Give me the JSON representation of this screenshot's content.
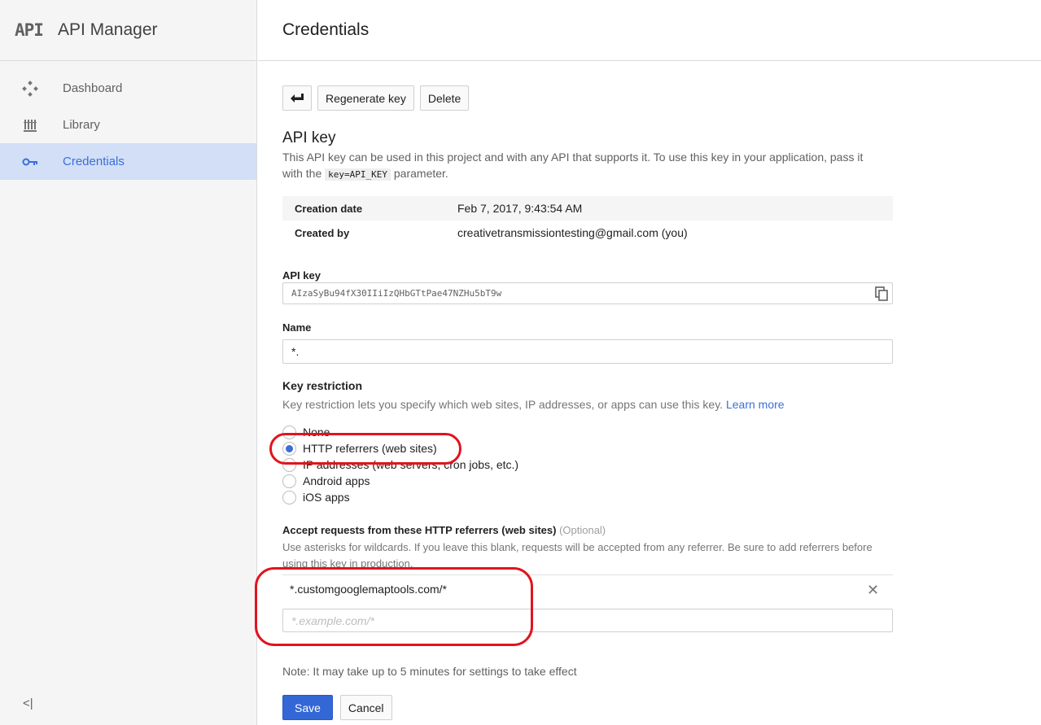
{
  "brand": {
    "logo": "API",
    "title": "API Manager"
  },
  "sidebar": {
    "items": [
      {
        "label": "Dashboard",
        "icon": "dashboard-icon"
      },
      {
        "label": "Library",
        "icon": "library-icon"
      },
      {
        "label": "Credentials",
        "icon": "key-icon",
        "active": true
      }
    ],
    "collapse_label": "<|"
  },
  "header": {
    "title": "Credentials"
  },
  "toolbar": {
    "back_icon": "back-arrow-icon",
    "regenerate_label": "Regenerate key",
    "delete_label": "Delete"
  },
  "apikey_section": {
    "title": "API key",
    "description_before": "This API key can be used in this project and with any API that supports it. To use this key in your application, pass it with the ",
    "code": "key=API_KEY",
    "description_after": " parameter."
  },
  "info": [
    {
      "key": "Creation date",
      "value": "Feb 7, 2017, 9:43:54 AM"
    },
    {
      "key": "Created by",
      "value": "creativetransmissiontesting@gmail.com (you)"
    }
  ],
  "api_key_field": {
    "label": "API key",
    "value": "AIzaSyBu94fX30IIiIzQHbGTtPae47NZHu5bT9w"
  },
  "name_field": {
    "label": "Name",
    "value": "*."
  },
  "key_restriction": {
    "title": "Key restriction",
    "description": "Key restriction lets you specify which web sites, IP addresses, or apps can use this key. ",
    "learn_more": "Learn more",
    "options": [
      {
        "label": "None",
        "checked": false
      },
      {
        "label": "HTTP referrers (web sites)",
        "checked": true
      },
      {
        "label": "IP addresses (web servers, cron jobs, etc.)",
        "checked": false
      },
      {
        "label": "Android apps",
        "checked": false
      },
      {
        "label": "iOS apps",
        "checked": false
      }
    ]
  },
  "referrers": {
    "title": "Accept requests from these HTTP referrers (web sites)",
    "optional": "(Optional)",
    "description": "Use asterisks for wildcards. If you leave this blank, requests will be accepted from any referrer. Be sure to add referrers before using this key in production.",
    "items": [
      "*.customgooglemaptools.com/*"
    ],
    "placeholder": "*.example.com/*"
  },
  "note": "Note: It may take up to 5 minutes for settings to take effect",
  "actions": {
    "save": "Save",
    "cancel": "Cancel"
  },
  "colors": {
    "accent": "#3367d6",
    "annotation": "#e0141e",
    "sidebar_active_bg": "#d2dff7"
  }
}
